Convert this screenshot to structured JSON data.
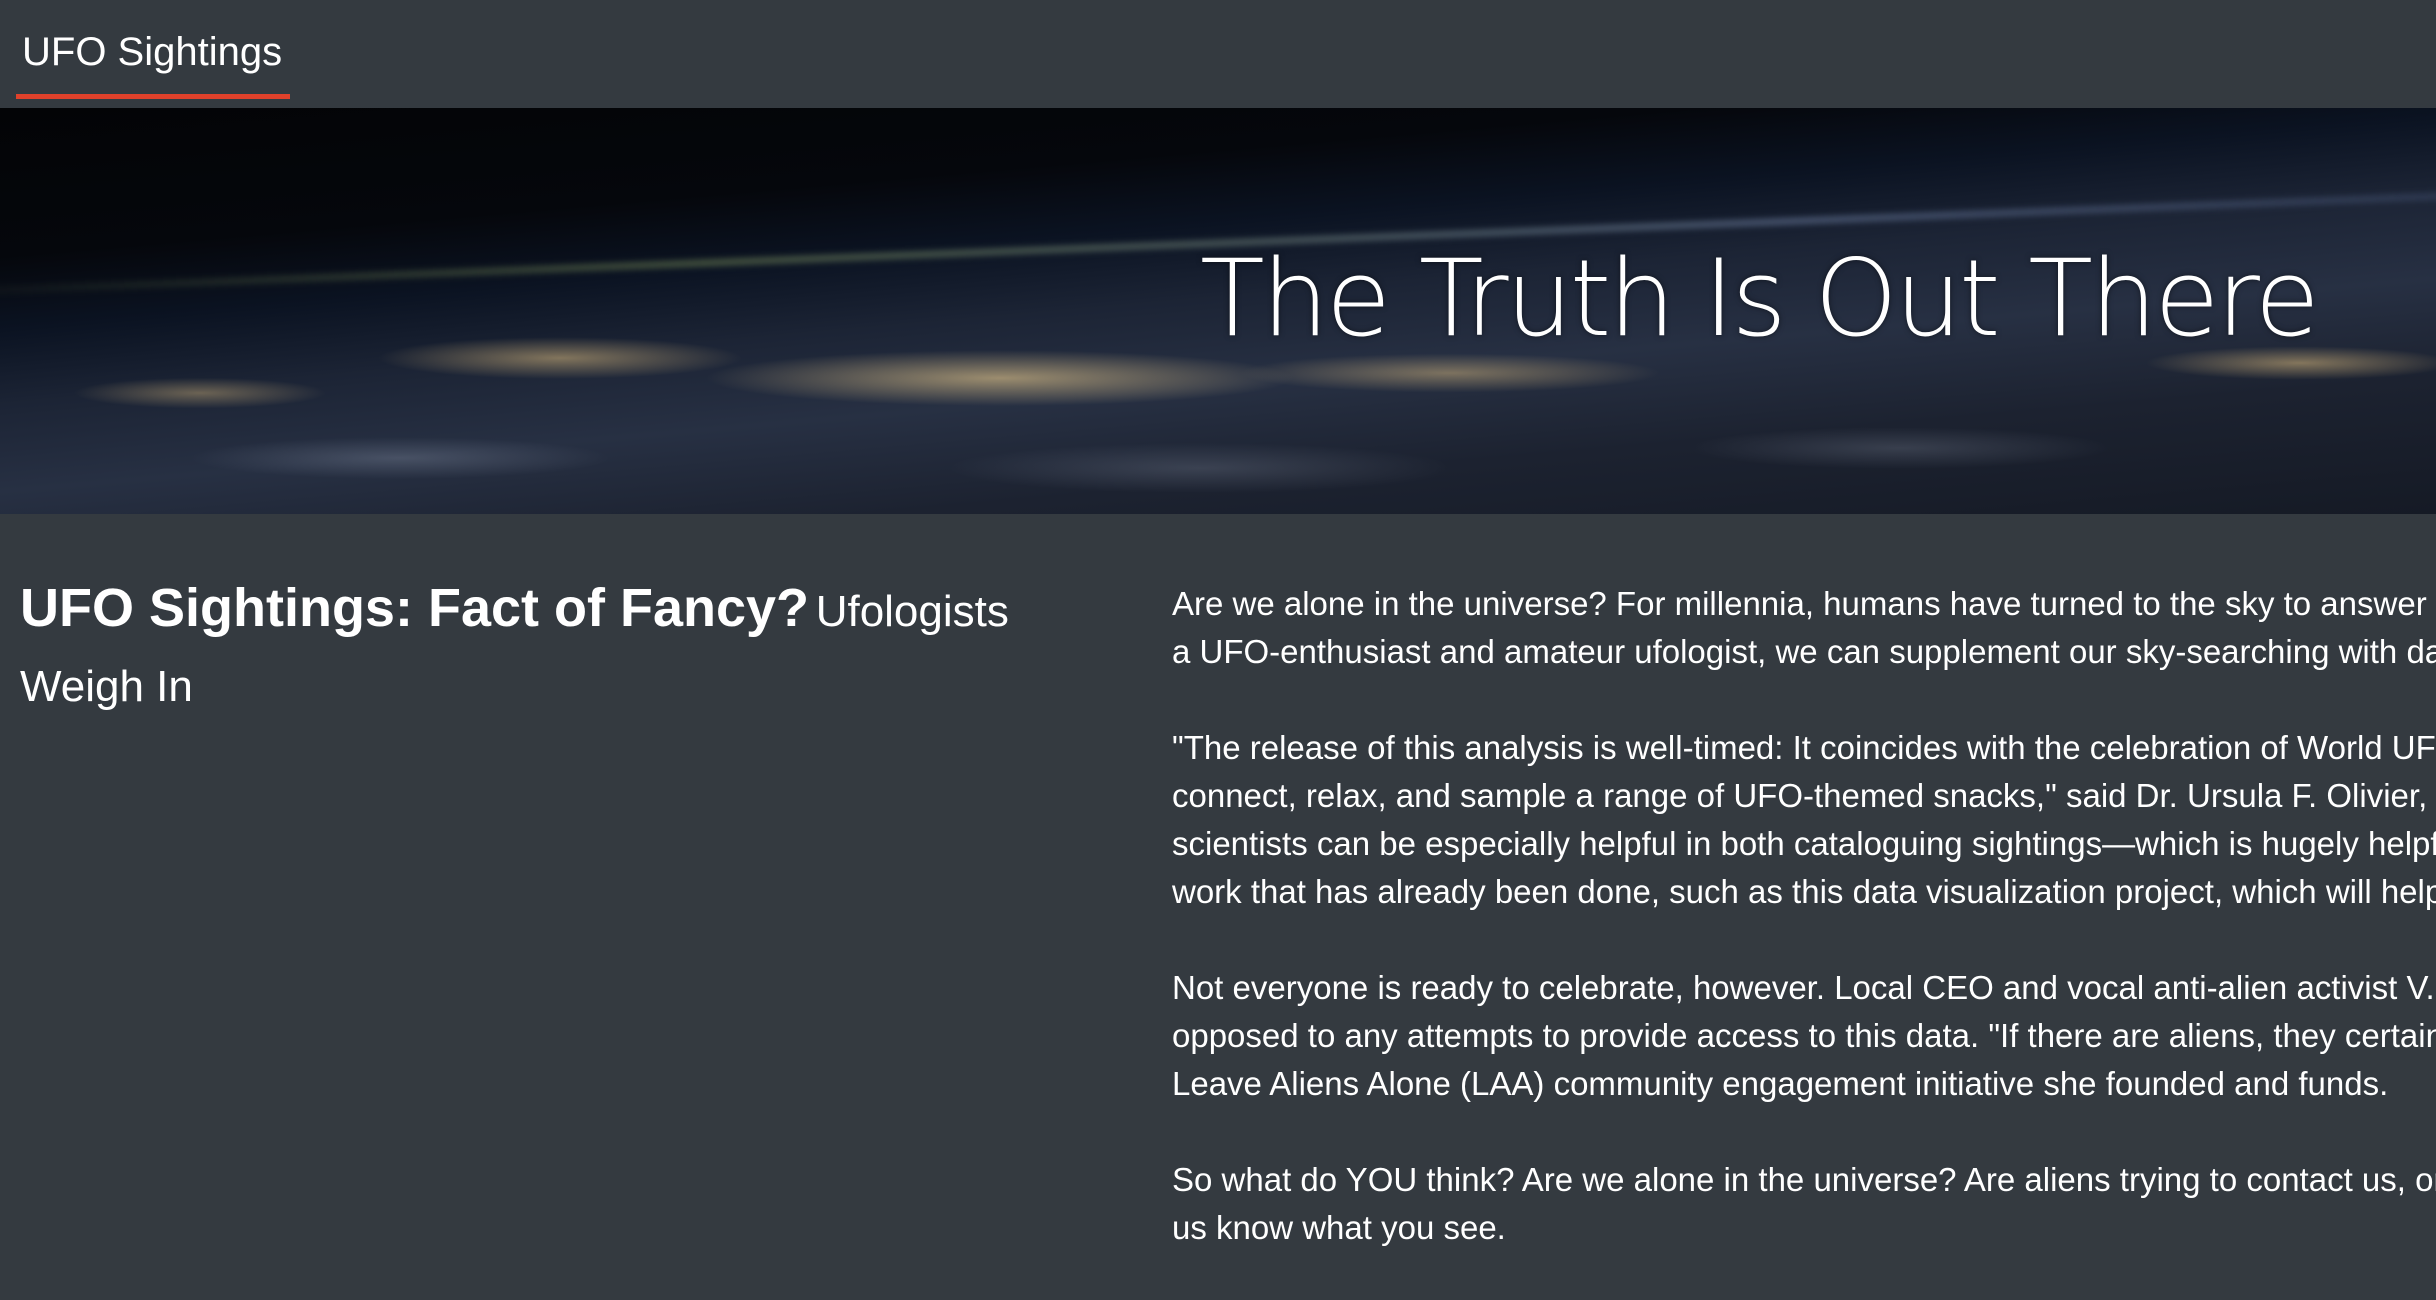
{
  "navbar": {
    "brand": "UFO Sightings",
    "accent_color": "#e0412b"
  },
  "hero": {
    "title": "The Truth Is Out There",
    "image": "earth-at-night-from-space"
  },
  "headline": {
    "main": "UFO Sightings: Fact of Fancy?",
    "sub": "Ufologists Weigh In"
  },
  "article": {
    "paragraphs": [
      "Are we alone in the universe? For millennia, humans have turned to the sky to answer th\na UFO-enthusiast and amateur ufologist, we can supplement our sky-searching with dat",
      "\"The release of this analysis is well-timed: It coincides with the celebration of World UF\nconnect, relax, and sample a range of UFO-themed snacks,\" said Dr. Ursula F. Olivier, th\nscientists can be especially helpful in both cataloguing sightings—which is hugely helpfu\nwork that has already been done, such as this data visualization project, which will help",
      "Not everyone is ready to celebrate, however. Local CEO and vocal anti-alien activist V. Is\nopposed to any attempts to provide access to this data. \"If there are aliens, they certain\nLeave Aliens Alone (LAA) community engagement initiative she founded and funds.",
      "So what do YOU think? Are we alone in the universe? Are aliens trying to contact us, or c\nus know what you see."
    ]
  },
  "colors": {
    "background": "#343a40",
    "text": "#ffffff"
  }
}
